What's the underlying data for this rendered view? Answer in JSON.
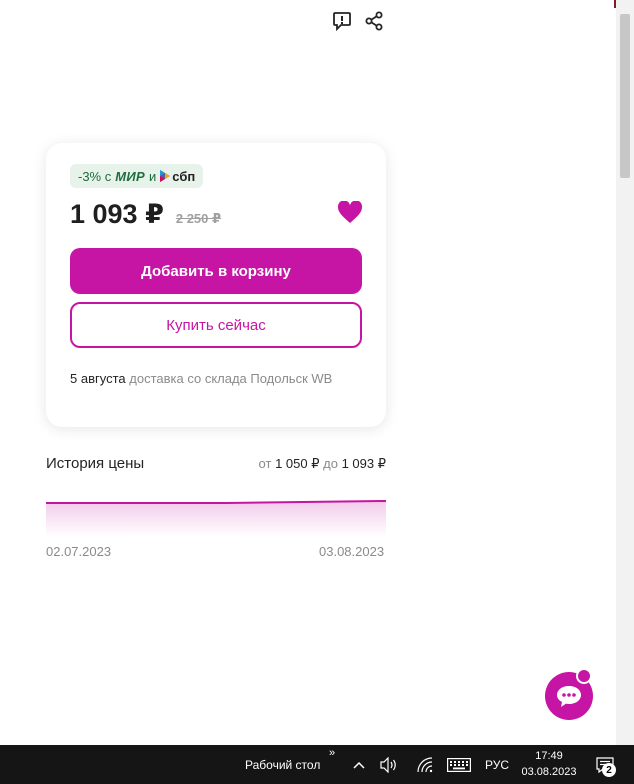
{
  "colors": {
    "accent": "#c614a4",
    "promo_bg": "#e7f3ea",
    "taskbar": "#151515"
  },
  "header": {
    "icons": [
      "report-icon",
      "share-icon"
    ]
  },
  "product_card": {
    "promo": {
      "discount": "-3% с",
      "mir": "МИР",
      "and": "и",
      "sbp": "сбп"
    },
    "price": "1 093 ₽",
    "old_price": "2 250 ₽",
    "add_to_cart_label": "Добавить в корзину",
    "buy_now_label": "Купить сейчас",
    "delivery": {
      "date": "5 августа",
      "text": "доставка со склада Подольск WB"
    }
  },
  "price_history": {
    "title": "История цены",
    "from_label": "от",
    "from_value": "1 050 ₽",
    "to_label": "до",
    "to_value": "1 093 ₽",
    "start_date": "02.07.2023",
    "end_date": "03.08.2023"
  },
  "taskbar": {
    "desktop_label": "Рабочий стол",
    "chevron": "»",
    "language": "РУС",
    "time": "17:49",
    "date": "03.08.2023",
    "notification_count": "2"
  }
}
